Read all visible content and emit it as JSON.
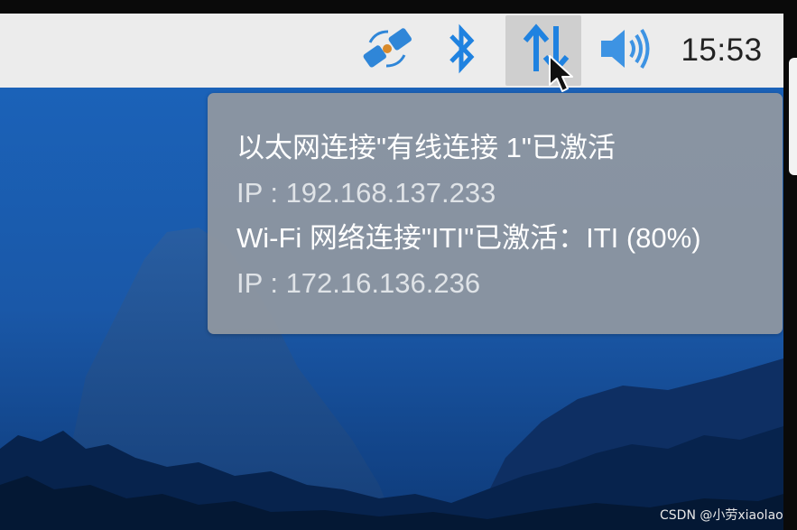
{
  "taskbar": {
    "tray_icons": [
      {
        "name": "app-indicator-icon",
        "color": "#2f86d8",
        "accent": "#d98a2a"
      },
      {
        "name": "bluetooth-icon",
        "color": "#1f82e0"
      },
      {
        "name": "network-updown-icon",
        "color": "#1f82e0",
        "active": true
      },
      {
        "name": "volume-icon",
        "color": "#3d93e3"
      }
    ],
    "clock": "15:53"
  },
  "tooltip": {
    "ethernet_status": "以太网连接\"有线连接 1\"已激活",
    "ethernet_ip": "IP : 192.168.137.233",
    "wifi_status": "Wi-Fi 网络连接\"ITI\"已激活：ITI (80%)",
    "wifi_ip": "IP : 172.16.136.236"
  },
  "watermark": "CSDN @小劳xiaolao",
  "colors": {
    "taskbar_bg": "#ececec",
    "tooltip_bg": "#9198a0",
    "desktop_blue": "#1d5fb0"
  }
}
